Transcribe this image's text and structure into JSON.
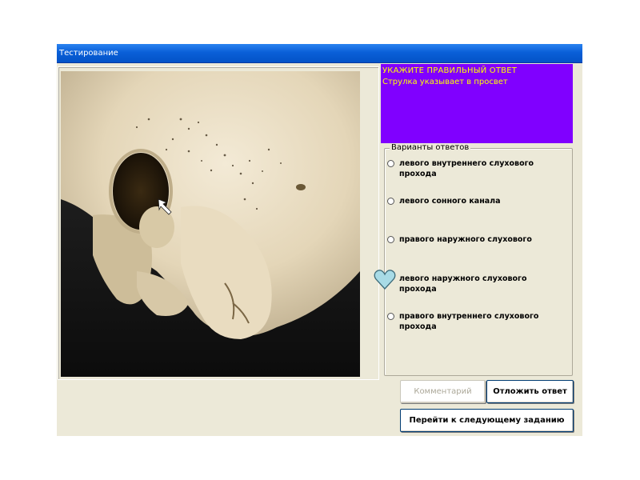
{
  "window": {
    "title": "Тестирование"
  },
  "question": {
    "title": "УКАЖИТЕ ПРАВИЛЬНЫЙ ОТВЕТ",
    "subtitle": "Струлка указывает в просвет",
    "panel_color": "#8000FF",
    "text_color": "#FFFF00"
  },
  "answers": {
    "legend": "Варианты ответов",
    "options": [
      {
        "label": "левого внутреннего слухового прохода",
        "selected": false
      },
      {
        "label": "левого сонного канала",
        "selected": false
      },
      {
        "label": "правого наружного слухового",
        "selected": false
      },
      {
        "label": "левого наружного слухового прохода",
        "selected": false
      },
      {
        "label": "правого внутреннего слухового прохода",
        "selected": false
      }
    ]
  },
  "buttons": {
    "comment": "Комментарий",
    "postpone": "Отложить ответ",
    "next": "Перейти к следующему заданию"
  },
  "icons": {
    "pointer_marker": "heart-icon",
    "image_arrow": "arrow-icon"
  }
}
